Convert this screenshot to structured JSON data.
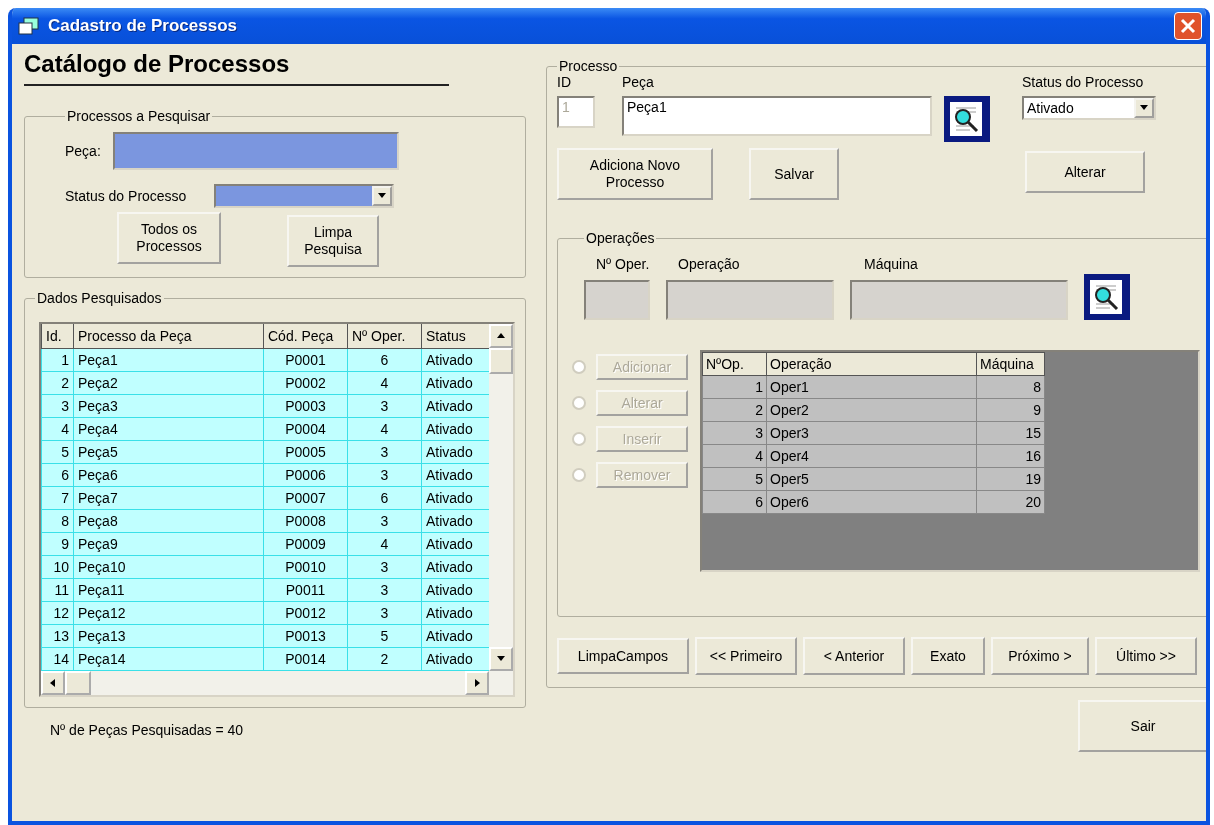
{
  "window": {
    "title": "Cadastro de Processos"
  },
  "catalog_title": "Catálogo de Processos",
  "search_group": {
    "legend": "Processos a Pesquisar",
    "peca_label": "Peça:",
    "status_label": "Status do Processo",
    "buttons": [
      "Todos os Processos",
      "Limpa Pesquisa"
    ]
  },
  "results": {
    "legend": "Dados Pesquisados",
    "columns": [
      "Id.",
      "Processo da Peça",
      "Cód. Peça",
      "Nº Oper.",
      "Status"
    ],
    "rows": [
      [
        "1",
        "Peça1",
        "P0001",
        "6",
        "Ativado"
      ],
      [
        "2",
        "Peça2",
        "P0002",
        "4",
        "Ativado"
      ],
      [
        "3",
        "Peça3",
        "P0003",
        "3",
        "Ativado"
      ],
      [
        "4",
        "Peça4",
        "P0004",
        "4",
        "Ativado"
      ],
      [
        "5",
        "Peça5",
        "P0005",
        "3",
        "Ativado"
      ],
      [
        "6",
        "Peça6",
        "P0006",
        "3",
        "Ativado"
      ],
      [
        "7",
        "Peça7",
        "P0007",
        "6",
        "Ativado"
      ],
      [
        "8",
        "Peça8",
        "P0008",
        "3",
        "Ativado"
      ],
      [
        "9",
        "Peça9",
        "P0009",
        "4",
        "Ativado"
      ],
      [
        "10",
        "Peça10",
        "P0010",
        "3",
        "Ativado"
      ],
      [
        "11",
        "Peça11",
        "P0011",
        "3",
        "Ativado"
      ],
      [
        "12",
        "Peça12",
        "P0012",
        "3",
        "Ativado"
      ],
      [
        "13",
        "Peça13",
        "P0013",
        "5",
        "Ativado"
      ],
      [
        "14",
        "Peça14",
        "P0014",
        "2",
        "Ativado"
      ]
    ],
    "count_text": "Nº de Peças Pesquisadas = 40"
  },
  "process": {
    "legend": "Processo",
    "id_label": "ID",
    "id_value": "1",
    "id_disabled": true,
    "peca_label": "Peça",
    "peca_value": "Peça1",
    "status_label": "Status do Processo",
    "status_value": "Ativado",
    "buttons": [
      "Adiciona Novo Processo",
      "Salvar",
      "Alterar"
    ]
  },
  "operations": {
    "legend": "Operações",
    "fields": [
      {
        "label": "Nº Oper.",
        "disabled": true
      },
      {
        "label": "Operação",
        "disabled": true
      },
      {
        "label": "Máquina",
        "disabled": true
      }
    ],
    "actions": [
      {
        "label": "Adicionar",
        "disabled": true,
        "checked": false
      },
      {
        "label": "Alterar",
        "disabled": true,
        "checked": false
      },
      {
        "label": "Inserir",
        "disabled": true,
        "checked": false
      },
      {
        "label": "Remover",
        "disabled": true,
        "checked": false
      }
    ],
    "columns": [
      "NºOp.",
      "Operação",
      "Máquina"
    ],
    "rows": [
      [
        "1",
        "Oper1",
        "8"
      ],
      [
        "2",
        "Oper2",
        "9"
      ],
      [
        "3",
        "Oper3",
        "15"
      ],
      [
        "4",
        "Oper4",
        "16"
      ],
      [
        "5",
        "Oper5",
        "19"
      ],
      [
        "6",
        "Oper6",
        "20"
      ]
    ]
  },
  "nav_buttons": [
    "LimpaCampos",
    "<< Primeiro",
    "<  Anterior",
    "Exato",
    "Próximo  >",
    "Último >>"
  ],
  "exit_button": "Sair"
}
